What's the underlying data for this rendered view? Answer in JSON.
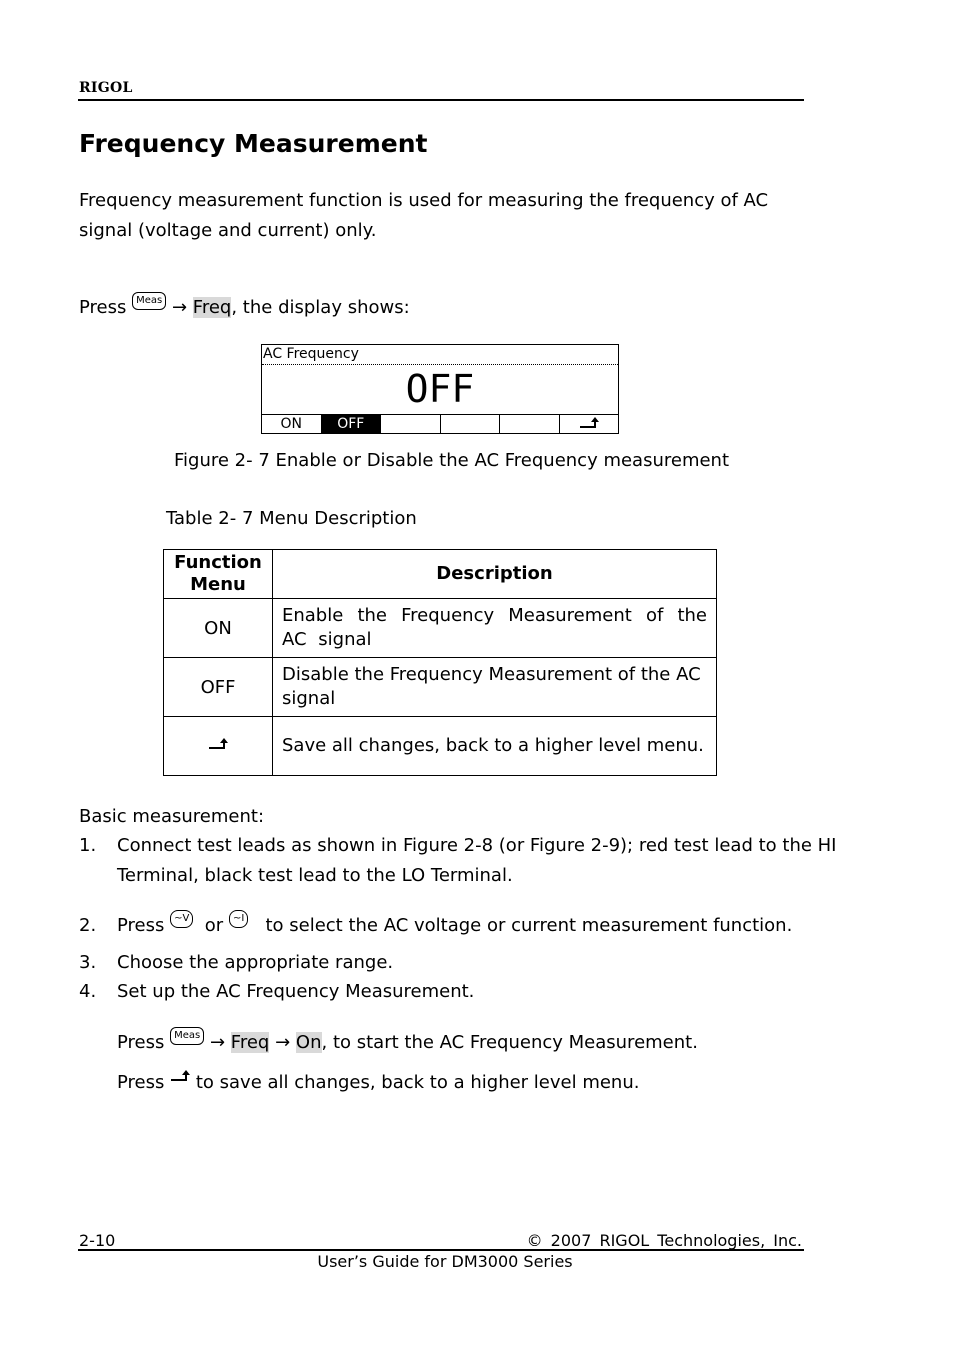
{
  "header": {
    "brand": "RIGOL"
  },
  "title": "Frequency Measurement",
  "intro": "Frequency measurement function is used for measuring the frequency of AC signal (voltage and current) only.",
  "press_line": {
    "press": "Press",
    "key": "Meas",
    "arrow": "→",
    "softkey": "Freq",
    "rest": ", the display shows:"
  },
  "lcd": {
    "title": "AC Frequency",
    "value": "OFF",
    "softkeys": [
      {
        "label": "ON",
        "active": false
      },
      {
        "label": "OFF",
        "active": true
      },
      {
        "label": "",
        "active": false
      },
      {
        "label": "",
        "active": false
      },
      {
        "label": "",
        "active": false
      },
      {
        "label": "back-icon",
        "active": false
      }
    ]
  },
  "figure_caption": "Figure 2- 7 Enable or Disable the AC Frequency measurement",
  "table_caption": "Table 2- 7 Menu Description",
  "table": {
    "headers": [
      "Function Menu",
      "Description"
    ],
    "rows": [
      {
        "menu": "ON",
        "description": "Enable the Frequency Measurement of the AC signal"
      },
      {
        "menu": "OFF",
        "description": "Disable the Frequency Measurement of the AC signal"
      },
      {
        "menu": "back-icon",
        "description": "Save all changes, back to a higher level menu."
      }
    ]
  },
  "basic": {
    "heading": "Basic measurement:",
    "steps": [
      {
        "num": "1.",
        "line1": "Connect test leads as shown in Figure 2-8 (or Figure 2-9); red test lead to the HI",
        "line2": "Terminal, black test lead to the LO Terminal."
      },
      {
        "num": "2.",
        "press": "Press",
        "key1": "~V",
        "or": "or",
        "key2": "~I",
        "rest": "to select the AC voltage or current measurement function."
      },
      {
        "num": "3.",
        "text": "Choose the appropriate range."
      },
      {
        "num": "4.",
        "text": "Set up the AC Frequency Measurement."
      }
    ],
    "sub1": {
      "press": "Press",
      "key": "Meas",
      "arrow": "→",
      "soft1": "Freq",
      "soft2": "On",
      "rest": ", to start the AC Frequency Measurement."
    },
    "sub2": {
      "press": "Press",
      "rest": "to save all changes, back to a higher level menu."
    }
  },
  "footer": {
    "page": "2-10",
    "copyright": "© 2007 RIGOL Technologies, Inc.",
    "guide": "User’s Guide for DM3000 Series"
  }
}
